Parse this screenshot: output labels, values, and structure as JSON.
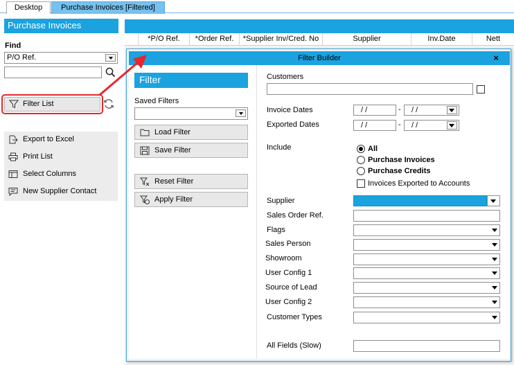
{
  "tabs": [
    {
      "label": "Desktop"
    },
    {
      "label": "Purchase Invoices [Filtered]"
    }
  ],
  "left_panel": {
    "title": "Purchase Invoices",
    "find_label": "Find",
    "find_field_selected": "P/O Ref.",
    "search_value": "",
    "filter_list_label": "Filter List",
    "actions": [
      {
        "label": "Export to Excel",
        "icon": "export-icon"
      },
      {
        "label": "Print List",
        "icon": "printer-icon"
      },
      {
        "label": "Select Columns",
        "icon": "columns-icon"
      },
      {
        "label": "New Supplier Contact",
        "icon": "contact-icon"
      }
    ]
  },
  "grid": {
    "columns": [
      "*P/O Ref.",
      "*Order Ref.",
      "*Supplier Inv/Cred. No",
      "Supplier",
      "Inv.Date",
      "Nett"
    ]
  },
  "filter_builder": {
    "title": "Filter Builder",
    "close_symbol": "×",
    "filter_header": "Filter",
    "saved_filters_label": "Saved Filters",
    "saved_filters_value": "",
    "load_filter": "Load Filter",
    "save_filter": "Save Filter",
    "reset_filter": "Reset Filter",
    "apply_filter": "Apply Filter",
    "customers_label": "Customers",
    "customers_value": "",
    "invoice_dates_label": "Invoice Dates",
    "exported_dates_label": "Exported Dates",
    "date_placeholder": "/ /",
    "date_separator": "-",
    "include_label": "Include",
    "include_options": [
      {
        "label": "All",
        "selected": true
      },
      {
        "label": "Purchase Invoices",
        "selected": false
      },
      {
        "label": "Purchase Credits",
        "selected": false
      }
    ],
    "exported_checkbox_label": "Invoices Exported to Accounts",
    "fields": [
      {
        "label": "Supplier",
        "type": "select"
      },
      {
        "label": "Sales Order Ref.",
        "type": "text"
      },
      {
        "label": "Flags",
        "type": "select"
      },
      {
        "label": "Sales Person",
        "type": "select"
      },
      {
        "label": "Showroom",
        "type": "select"
      },
      {
        "label": "User Config 1",
        "type": "select"
      },
      {
        "label": "Source of Lead",
        "type": "select"
      },
      {
        "label": "User Config 2",
        "type": "select"
      },
      {
        "label": "Customer Types",
        "type": "select"
      }
    ],
    "all_fields_label": "All Fields (Slow)",
    "all_fields_value": ""
  },
  "colors": {
    "accent": "#1aa3df",
    "tab_active": "#76c1ef",
    "highlight": "#e8262b"
  }
}
